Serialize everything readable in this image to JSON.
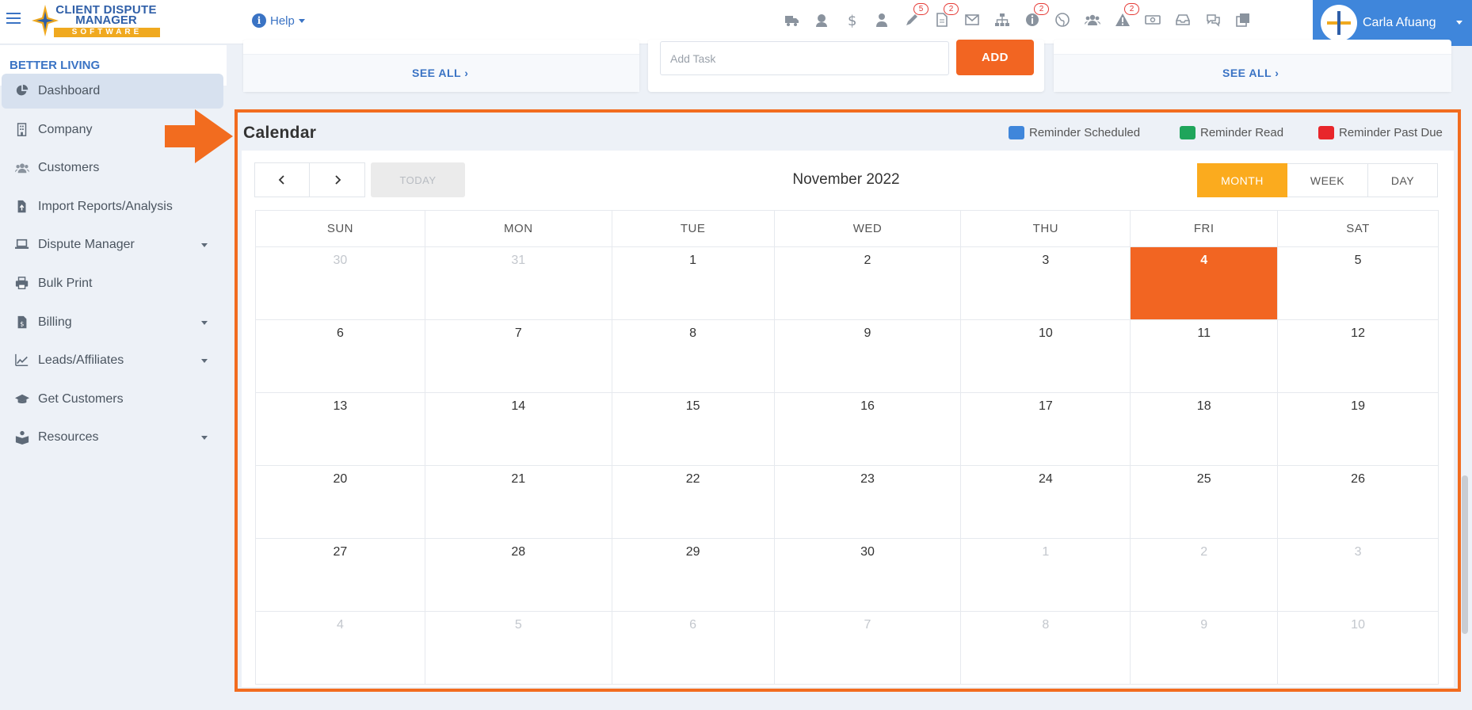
{
  "logo": {
    "line1": "CLIENT DISPUTE",
    "line2": "MANAGER",
    "line3": "SOFTWARE"
  },
  "help": {
    "label": "Help"
  },
  "top_icons": [
    {
      "name": "truck-icon",
      "badge": ""
    },
    {
      "name": "support-agent-icon",
      "badge": ""
    },
    {
      "name": "dollar-icon",
      "badge": ""
    },
    {
      "name": "user-tie-icon",
      "badge": ""
    },
    {
      "name": "pen-icon",
      "badge": "5"
    },
    {
      "name": "document-icon",
      "badge": "2"
    },
    {
      "name": "envelope-icon",
      "badge": ""
    },
    {
      "name": "sitemap-icon",
      "badge": ""
    },
    {
      "name": "info-icon",
      "badge": "2"
    },
    {
      "name": "globe-icon",
      "badge": ""
    },
    {
      "name": "users-icon",
      "badge": ""
    },
    {
      "name": "warning-icon",
      "badge": "2"
    },
    {
      "name": "money-icon",
      "badge": ""
    },
    {
      "name": "inbox-icon",
      "badge": ""
    },
    {
      "name": "chat-icon",
      "badge": ""
    },
    {
      "name": "copy-icon",
      "badge": ""
    }
  ],
  "user": {
    "name": "Carla Afuang"
  },
  "sidebar": {
    "company": "BETTER LIVING",
    "items": [
      {
        "label": "Dashboard",
        "icon": "pie-chart-icon",
        "active": true,
        "caret": false
      },
      {
        "label": "Company",
        "icon": "building-icon",
        "active": false,
        "caret": false
      },
      {
        "label": "Customers",
        "icon": "users-icon",
        "active": false,
        "caret": false
      },
      {
        "label": "Import Reports/Analysis",
        "icon": "file-upload-icon",
        "active": false,
        "caret": false
      },
      {
        "label": "Dispute Manager",
        "icon": "laptop-icon",
        "active": false,
        "caret": true
      },
      {
        "label": "Bulk Print",
        "icon": "printer-icon",
        "active": false,
        "caret": false
      },
      {
        "label": "Billing",
        "icon": "invoice-icon",
        "active": false,
        "caret": true
      },
      {
        "label": "Leads/Affiliates",
        "icon": "chart-line-icon",
        "active": false,
        "caret": true
      },
      {
        "label": "Get Customers",
        "icon": "graduation-cap-icon",
        "active": false,
        "caret": false
      },
      {
        "label": "Resources",
        "icon": "book-reader-icon",
        "active": false,
        "caret": true
      }
    ]
  },
  "cards": {
    "left_see_all": "SEE ALL",
    "task_placeholder": "Add Task",
    "add_label": "ADD",
    "right_see_all": "SEE ALL"
  },
  "calendar": {
    "title": "Calendar",
    "legend": [
      {
        "label": "Reminder Scheduled",
        "color": "#3f86db"
      },
      {
        "label": "Reminder Read",
        "color": "#1fa55b"
      },
      {
        "label": "Reminder Past Due",
        "color": "#e8262b"
      }
    ],
    "today_label": "TODAY",
    "month_title": "November 2022",
    "views": [
      {
        "label": "MONTH",
        "active": true
      },
      {
        "label": "WEEK",
        "active": false
      },
      {
        "label": "DAY",
        "active": false
      }
    ],
    "weekdays": [
      "SUN",
      "MON",
      "TUE",
      "WED",
      "THU",
      "FRI",
      "SAT"
    ],
    "weeks": [
      [
        {
          "d": "30",
          "m": true
        },
        {
          "d": "31",
          "m": true
        },
        {
          "d": "1"
        },
        {
          "d": "2"
        },
        {
          "d": "3"
        },
        {
          "d": "4",
          "today": true
        },
        {
          "d": "5"
        }
      ],
      [
        {
          "d": "6"
        },
        {
          "d": "7"
        },
        {
          "d": "8"
        },
        {
          "d": "9"
        },
        {
          "d": "10"
        },
        {
          "d": "11"
        },
        {
          "d": "12"
        }
      ],
      [
        {
          "d": "13"
        },
        {
          "d": "14"
        },
        {
          "d": "15"
        },
        {
          "d": "16"
        },
        {
          "d": "17"
        },
        {
          "d": "18"
        },
        {
          "d": "19"
        }
      ],
      [
        {
          "d": "20"
        },
        {
          "d": "21"
        },
        {
          "d": "22"
        },
        {
          "d": "23"
        },
        {
          "d": "24"
        },
        {
          "d": "25"
        },
        {
          "d": "26"
        }
      ],
      [
        {
          "d": "27"
        },
        {
          "d": "28"
        },
        {
          "d": "29"
        },
        {
          "d": "30"
        },
        {
          "d": "1",
          "m": true
        },
        {
          "d": "2",
          "m": true
        },
        {
          "d": "3",
          "m": true
        }
      ],
      [
        {
          "d": "4",
          "m": true
        },
        {
          "d": "5",
          "m": true
        },
        {
          "d": "6",
          "m": true
        },
        {
          "d": "7",
          "m": true
        },
        {
          "d": "8",
          "m": true
        },
        {
          "d": "9",
          "m": true
        },
        {
          "d": "10",
          "m": true
        }
      ]
    ]
  },
  "colors": {
    "accent": "#f26522",
    "brand_blue": "#3f86db",
    "month_active": "#fbab1e"
  }
}
